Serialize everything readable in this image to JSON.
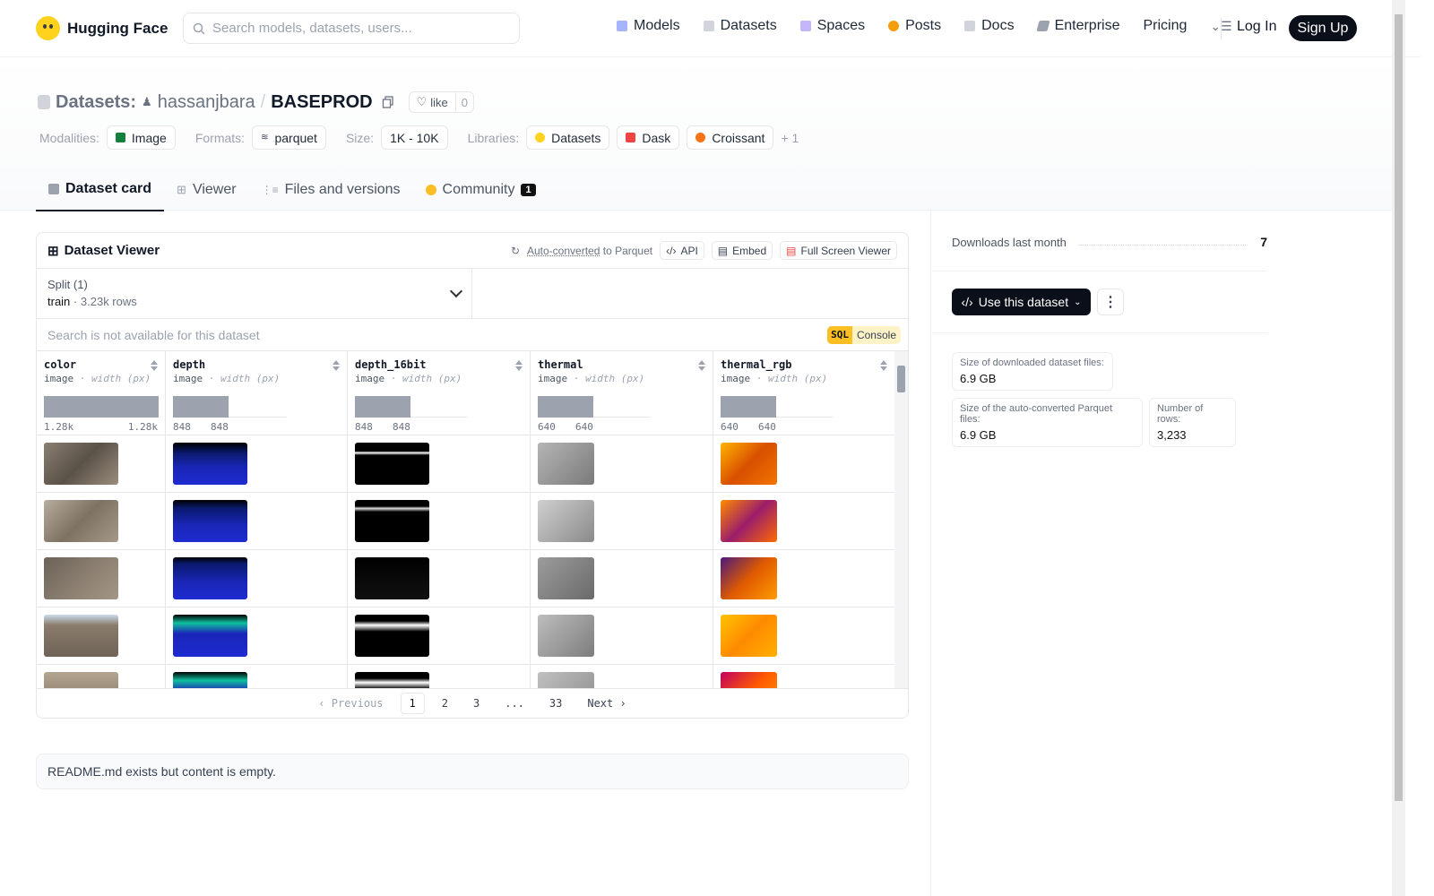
{
  "nav": {
    "brand": "Hugging Face",
    "search_placeholder": "Search models, datasets, users...",
    "links": [
      "Models",
      "Datasets",
      "Spaces",
      "Posts",
      "Docs",
      "Enterprise",
      "Pricing"
    ],
    "login": "Log In",
    "signup": "Sign Up"
  },
  "header": {
    "section": "Datasets:",
    "owner": "hassanjbara",
    "separator": "/",
    "repo": "BASEPROD",
    "like_label": "like",
    "like_count": "0",
    "modalities_label": "Modalities:",
    "modality": "Image",
    "formats_label": "Formats:",
    "format": "parquet",
    "size_label": "Size:",
    "size": "1K - 10K",
    "libraries_label": "Libraries:",
    "libraries": [
      "Datasets",
      "Dask",
      "Croissant"
    ],
    "libraries_more": "+ 1"
  },
  "tabs": [
    {
      "label": "Dataset card",
      "active": true
    },
    {
      "label": "Viewer"
    },
    {
      "label": "Files and versions"
    },
    {
      "label": "Community",
      "badge": "1"
    }
  ],
  "viewer": {
    "title": "Dataset Viewer",
    "auto_converted": "Auto-converted",
    "to_parquet": "to Parquet",
    "api": "API",
    "embed": "Embed",
    "full_screen": "Full Screen Viewer",
    "split_label": "Split (1)",
    "split_name": "train",
    "split_rows": "3.23k rows",
    "search_disabled": "Search is not available for this dataset",
    "sql_badge": "SQL",
    "sql_label": "Console",
    "columns": [
      {
        "name": "color",
        "type": "image",
        "stat": "width (px)",
        "min": "1.28k",
        "max": "1.28k"
      },
      {
        "name": "depth",
        "type": "image",
        "stat": "width (px)",
        "min": "848",
        "max": "848"
      },
      {
        "name": "depth_16bit",
        "type": "image",
        "stat": "width (px)",
        "min": "848",
        "max": "848"
      },
      {
        "name": "thermal",
        "type": "image",
        "stat": "width (px)",
        "min": "640",
        "max": "640"
      },
      {
        "name": "thermal_rgb",
        "type": "image",
        "stat": "width (px)",
        "min": "640",
        "max": "640"
      }
    ],
    "pager": {
      "previous": "Previous",
      "pages": [
        "1",
        "2",
        "3",
        "...",
        "33"
      ],
      "next": "Next"
    }
  },
  "readme": "README.md exists but content is empty.",
  "sidebar": {
    "downloads_label": "Downloads last month",
    "downloads": "7",
    "use_dataset": "Use this dataset",
    "stats": [
      {
        "label": "Size of downloaded dataset files:",
        "value": "6.9 GB"
      },
      {
        "label": "Size of the auto-converted Parquet files:",
        "value": "6.9 GB"
      },
      {
        "label": "Number of rows:",
        "value": "3,233"
      }
    ]
  }
}
